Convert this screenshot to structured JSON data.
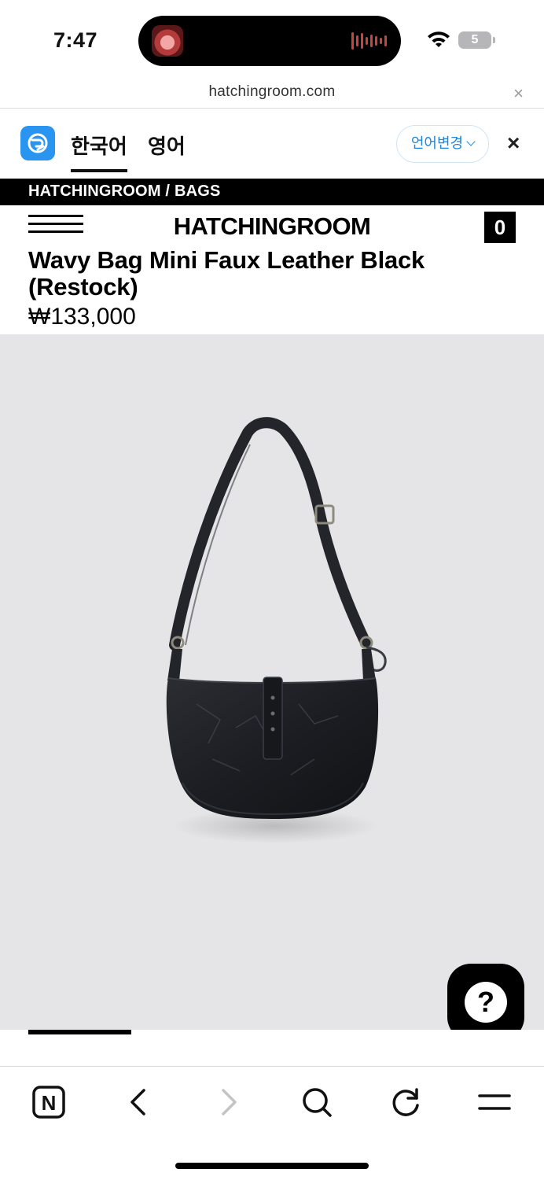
{
  "status_bar": {
    "time": "7:47",
    "battery": "5"
  },
  "url_bar": {
    "domain": "hatchingroom.com",
    "close_icon": "×"
  },
  "translate_bar": {
    "tabs": [
      {
        "label": "한국어",
        "active": true
      },
      {
        "label": "영어",
        "active": false
      }
    ],
    "change_language": "언어변경",
    "close_icon": "×"
  },
  "breadcrumb": "HATCHINGROOM / BAGS",
  "site_header": {
    "logo": "HATCHINGROOM",
    "cart_count": "0"
  },
  "product": {
    "title": "Wavy Bag Mini Faux Leather Black (Restock)",
    "price": "₩133,000",
    "image_background": "#e5e5e7",
    "slide_progress": 0.19
  },
  "help_button": {
    "glyph": "?"
  },
  "toolbar": {
    "buttons": [
      "naver-home-icon",
      "back-icon",
      "forward-icon",
      "search-icon",
      "reload-icon",
      "menu-icon"
    ],
    "home_glyph": "N"
  }
}
